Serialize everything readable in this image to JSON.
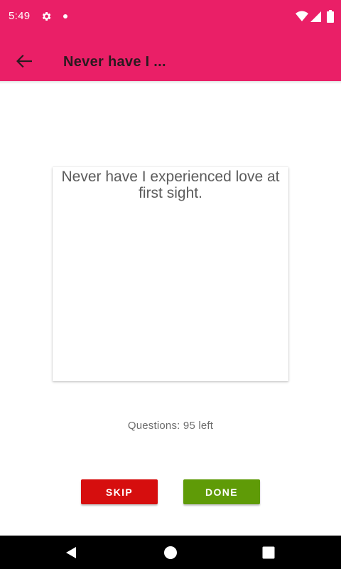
{
  "status_bar": {
    "time": "5:49",
    "icons": [
      "gear-icon",
      "notification-dot-icon",
      "wifi-icon",
      "signal-icon",
      "battery-icon"
    ]
  },
  "app_bar": {
    "back_icon": "arrow-left-icon",
    "title": "Never have I ..."
  },
  "card": {
    "question": "Never have I experienced love at first sight."
  },
  "remaining_text": "Questions: 95 left",
  "buttons": {
    "skip_label": "SKIP",
    "done_label": "DONE"
  },
  "nav_bar": {
    "icons": [
      "nav-back-icon",
      "nav-home-icon",
      "nav-recents-icon"
    ]
  },
  "colors": {
    "primary": "#ea1f67",
    "skip": "#d60e0e",
    "done": "#5f9b07",
    "title_text": "#2a1a1f",
    "body_text": "#5c5c5c"
  }
}
